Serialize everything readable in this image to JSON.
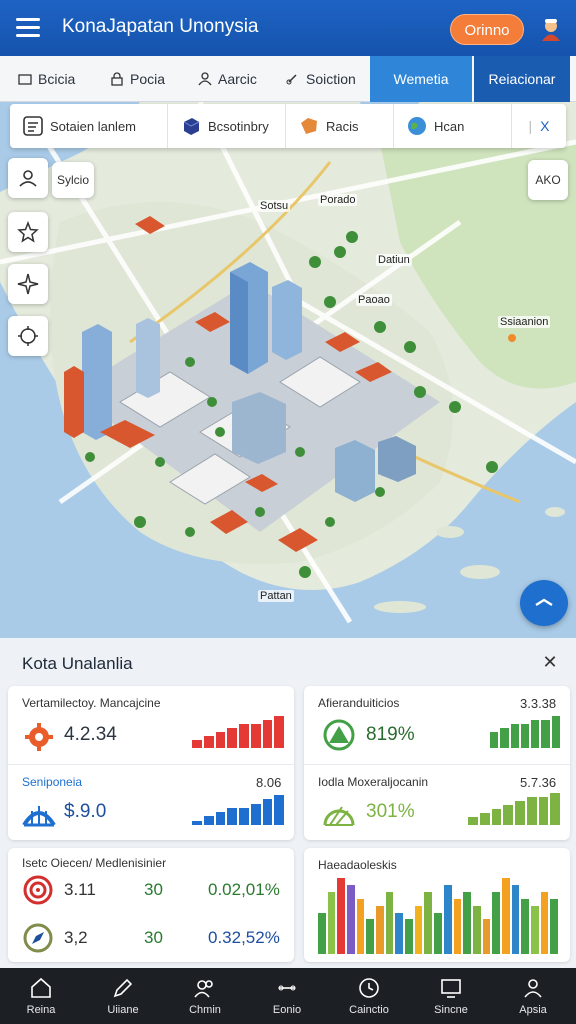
{
  "app": {
    "title": "KonaJapatan Unonysia",
    "cta_label": "Orinno"
  },
  "tabs": [
    {
      "label": "Bcicia"
    },
    {
      "label": "Pocia"
    },
    {
      "label": "Aarcic"
    },
    {
      "label": "Soiction"
    },
    {
      "label": "Wemetia"
    },
    {
      "label": "Reiacionar"
    }
  ],
  "search": {
    "segments": [
      {
        "label": "Sotaien lanlem",
        "icon": "document-icon"
      },
      {
        "label": "Bcsotinbry",
        "icon": "box-icon"
      },
      {
        "label": "Racis",
        "icon": "tag-icon"
      },
      {
        "label": "Hcan",
        "icon": "globe-icon"
      }
    ],
    "close_label": "X"
  },
  "map": {
    "chip_left": "Sylcio",
    "chip_right": "AKO",
    "labels": [
      {
        "text": "Sotsu"
      },
      {
        "text": "Porado"
      },
      {
        "text": "Datiun"
      },
      {
        "text": "Paoao"
      },
      {
        "text": "Ssiaanion"
      },
      {
        "text": "Pattan"
      }
    ]
  },
  "panel": {
    "title": "Kota Unalanlia",
    "cards": [
      {
        "rows": [
          {
            "label": "Vertamilectoy. Mancajcine",
            "value": "4.2.34",
            "icon": "gear-icon",
            "accent": "#e53935"
          },
          {
            "label": "Seniponeia",
            "value": "$.9.0",
            "secondary": "8.06",
            "icon": "bridge-icon",
            "accent": "#1e6fd0"
          }
        ]
      },
      {
        "rows": [
          {
            "label": "Afieranduiticios",
            "secondary": "3.3.38",
            "value": "819%",
            "icon": "triangle-icon",
            "accent": "#43a047"
          },
          {
            "label": "Iodla Moxeraljocanin",
            "secondary": "5.7.36",
            "value": "301%",
            "icon": "globe-grid-icon",
            "accent": "#7cb342"
          }
        ]
      },
      {
        "title": "Isetc  Oiecen/ Medlenisinier",
        "rows": [
          {
            "value": "3.11",
            "mid": "30",
            "pct": "0.02,01%",
            "icon": "target-icon"
          },
          {
            "value": "3,2",
            "mid": "30",
            "pct": "0.32,52%",
            "icon": "compass-icon"
          }
        ]
      },
      {
        "title": "Haeadaoleskis"
      }
    ]
  },
  "chart_data": [
    {
      "type": "bar",
      "title": "",
      "values": [
        2,
        3,
        4,
        5,
        6,
        6,
        7,
        8
      ],
      "color": "#e53935"
    },
    {
      "type": "bar",
      "title": "",
      "values": [
        1,
        2,
        3,
        4,
        4,
        5,
        6,
        7
      ],
      "color": "#1e6fd0"
    },
    {
      "type": "bar",
      "title": "",
      "values": [
        4,
        5,
        6,
        6,
        7,
        7,
        8
      ],
      "color": "#43a047"
    },
    {
      "type": "bar",
      "title": "",
      "values": [
        2,
        3,
        4,
        5,
        6,
        7,
        7,
        8
      ],
      "color": "#7cb342"
    },
    {
      "type": "bar",
      "title": "",
      "values": [
        6,
        9,
        11,
        10,
        8,
        5,
        7,
        9,
        6,
        5,
        7,
        9,
        6,
        10,
        8,
        9,
        7,
        5,
        9,
        11,
        10,
        8,
        7,
        9,
        8
      ],
      "colors": [
        "#43a047",
        "#8bc34a",
        "#e53935",
        "#7b5cc4",
        "#f4a020",
        "#43a047",
        "#e89a2a",
        "#7cb342",
        "#2e86c8",
        "#43a047",
        "#f2b21e",
        "#7cb342",
        "#43a047",
        "#2e86c8",
        "#f4a020",
        "#43a047",
        "#7cb342",
        "#e89a2a",
        "#43a047",
        "#f4a020",
        "#2e86c8",
        "#43a047",
        "#8bc34a",
        "#f4a020",
        "#43a047"
      ]
    }
  ],
  "bottom_nav": [
    {
      "label": "Reina",
      "icon": "home-icon"
    },
    {
      "label": "Uiiane",
      "icon": "pen-icon"
    },
    {
      "label": "Chmin",
      "icon": "people-icon"
    },
    {
      "label": "Eonio",
      "icon": "link-icon"
    },
    {
      "label": "Cainctio",
      "icon": "clock-icon"
    },
    {
      "label": "Sincne",
      "icon": "monitor-icon"
    },
    {
      "label": "Apsia",
      "icon": "user-icon"
    }
  ]
}
